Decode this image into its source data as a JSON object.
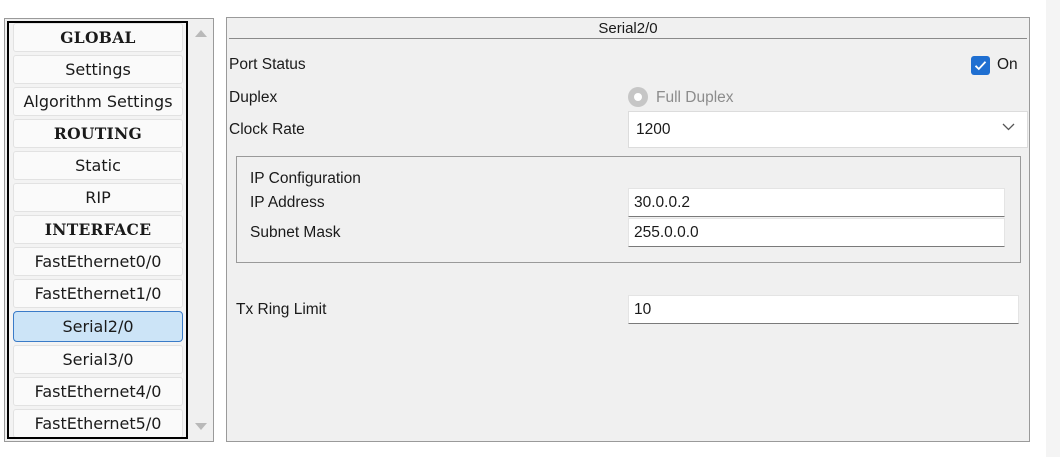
{
  "sidebar": {
    "items": [
      {
        "label": "GLOBAL",
        "type": "header"
      },
      {
        "label": "Settings",
        "type": "item"
      },
      {
        "label": "Algorithm Settings",
        "type": "item"
      },
      {
        "label": "ROUTING",
        "type": "header"
      },
      {
        "label": "Static",
        "type": "item"
      },
      {
        "label": "RIP",
        "type": "item"
      },
      {
        "label": "INTERFACE",
        "type": "header"
      },
      {
        "label": "FastEthernet0/0",
        "type": "item"
      },
      {
        "label": "FastEthernet1/0",
        "type": "item"
      },
      {
        "label": "Serial2/0",
        "type": "item",
        "selected": true
      },
      {
        "label": "Serial3/0",
        "type": "item"
      },
      {
        "label": "FastEthernet4/0",
        "type": "item"
      },
      {
        "label": "FastEthernet5/0",
        "type": "item"
      }
    ]
  },
  "panel": {
    "title": "Serial2/0",
    "port_status": {
      "label": "Port Status",
      "checked": true,
      "checkbox_label": "On"
    },
    "duplex": {
      "label": "Duplex",
      "option_label": "Full Duplex",
      "disabled": true
    },
    "clock_rate": {
      "label": "Clock Rate",
      "value": "1200"
    },
    "ip_config": {
      "title": "IP Configuration",
      "ip_address": {
        "label": "IP Address",
        "value": "30.0.0.2"
      },
      "subnet_mask": {
        "label": "Subnet Mask",
        "value": "255.0.0.0"
      }
    },
    "tx_ring_limit": {
      "label": "Tx Ring Limit",
      "value": "10"
    }
  },
  "colors": {
    "accent": "#1f6fd1",
    "selected_bg": "#cce4f7",
    "selected_border": "#3a7bc8",
    "panel_bg": "#f0f0f0"
  }
}
